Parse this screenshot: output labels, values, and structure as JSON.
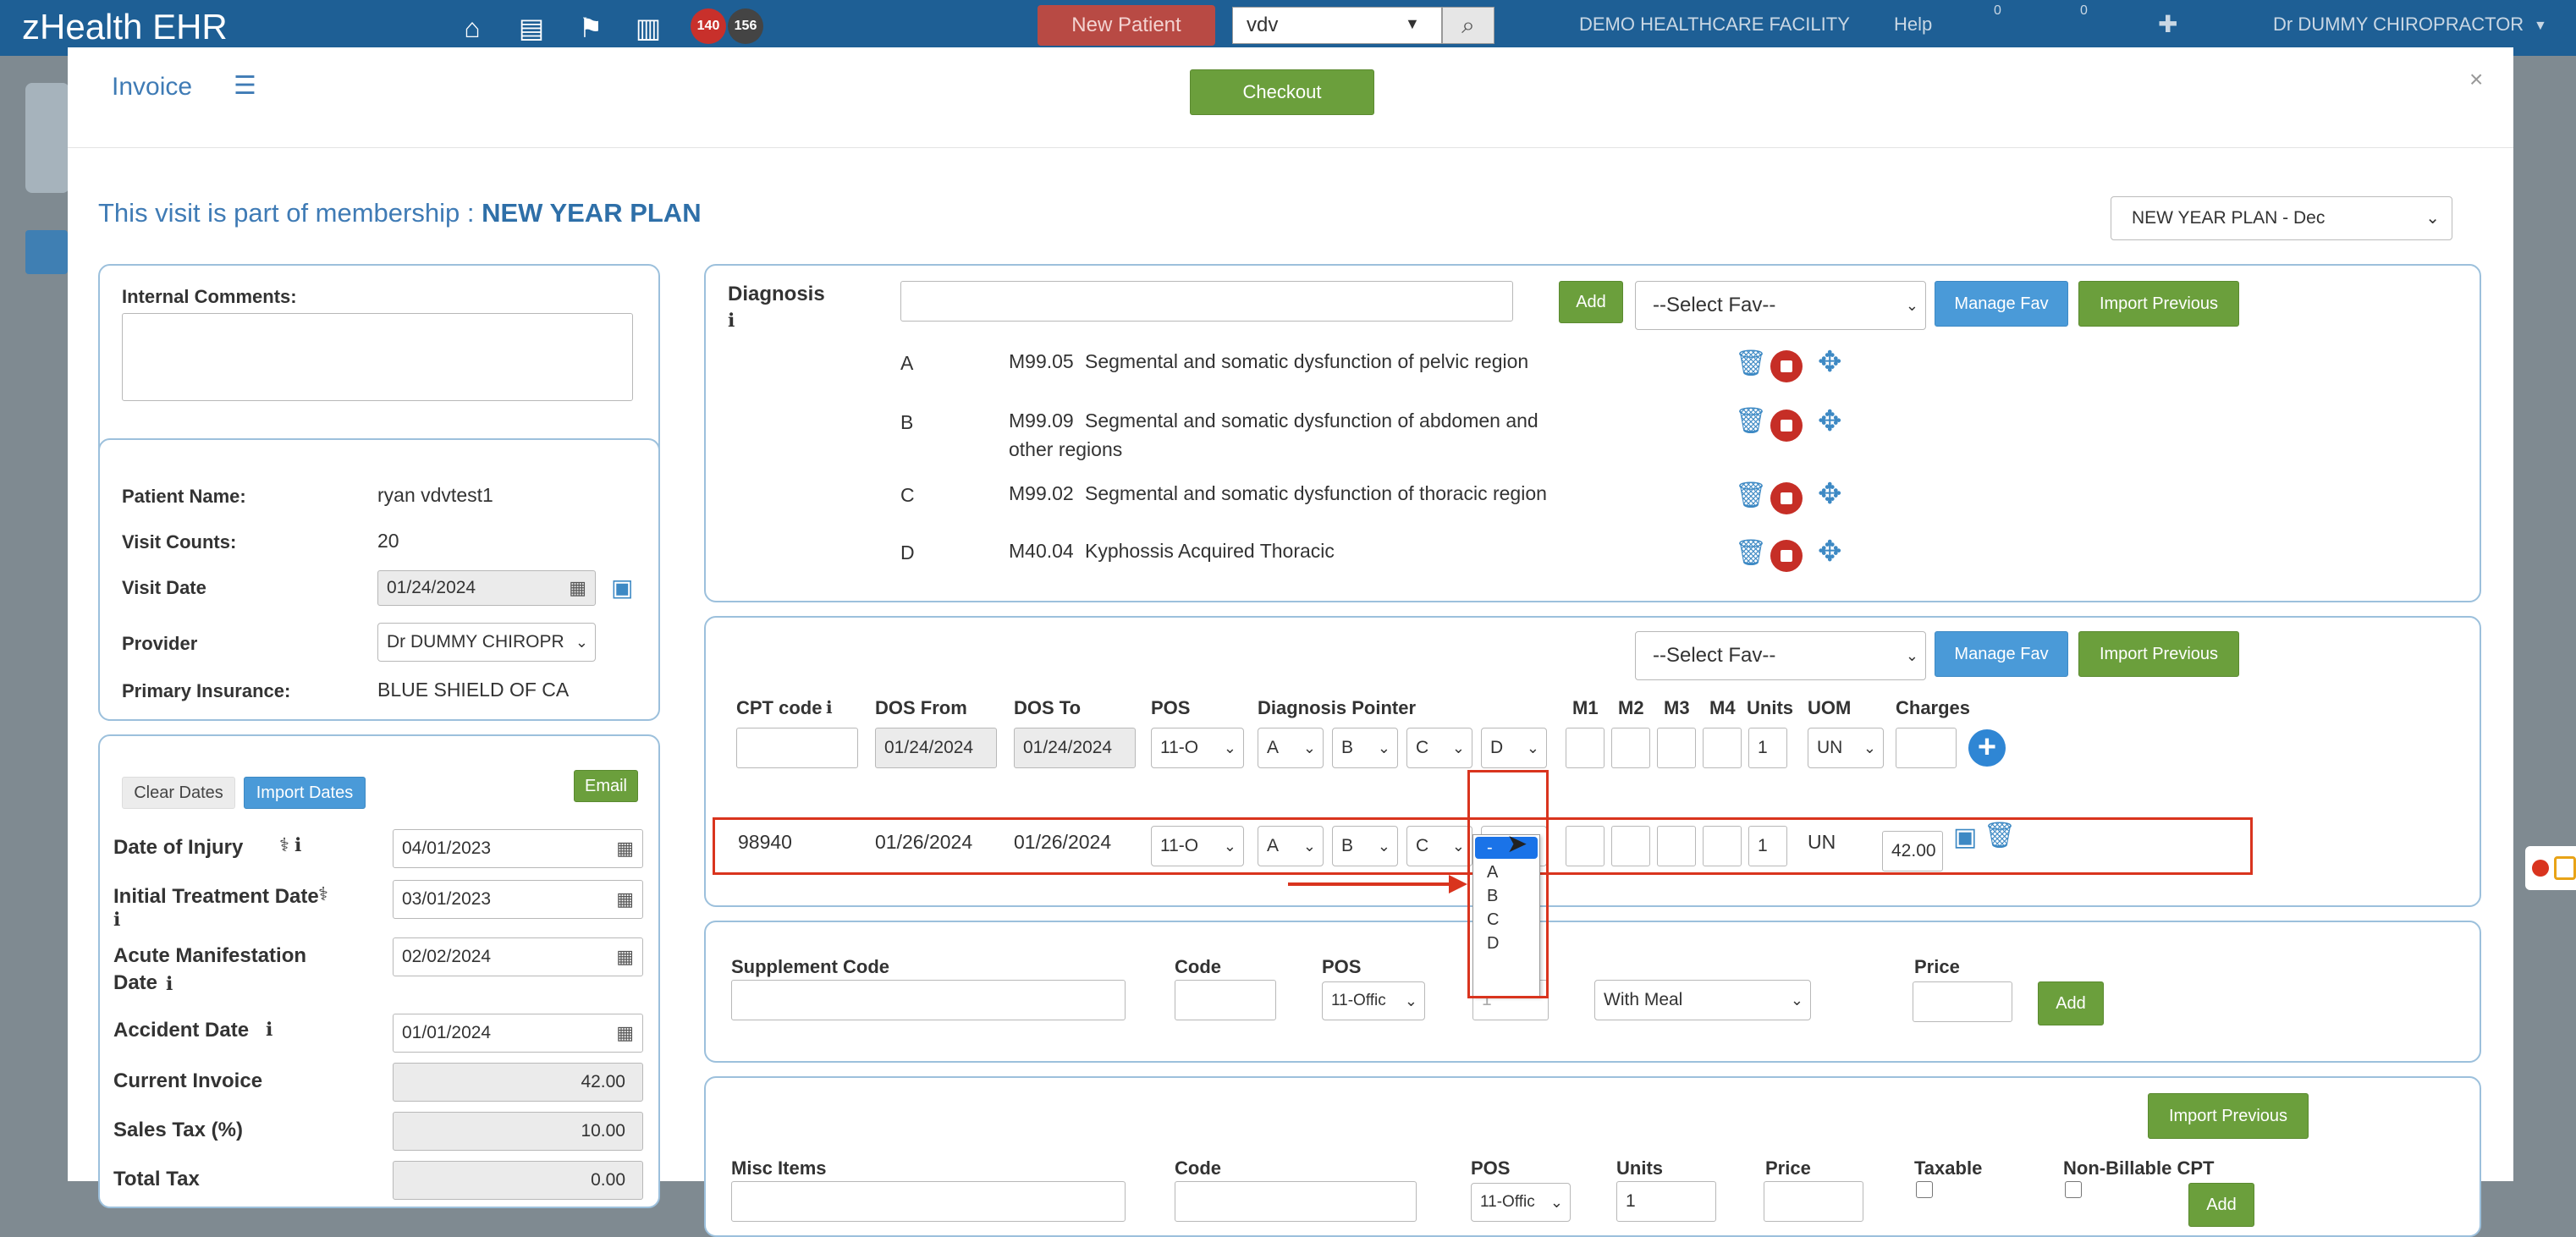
{
  "topbar": {
    "brand": "zHealth EHR",
    "badges": [
      "140",
      "156"
    ],
    "new_patient": "New Patient",
    "search_value": "vdv",
    "facility": "DEMO HEALTHCARE FACILITY",
    "help": "Help",
    "msg_count_1": "0",
    "msg_count_2": "0",
    "user": "Dr DUMMY CHIROPRACTOR"
  },
  "modal": {
    "title": "Invoice",
    "checkout": "Checkout",
    "close": "×",
    "membership_prefix": "This visit is part of membership : ",
    "membership_name": "NEW YEAR PLAN",
    "plan_select": "NEW YEAR PLAN - Dec"
  },
  "left": {
    "internal_comments_label": "Internal Comments:",
    "internal_comments_value": "",
    "patient_name_label": "Patient Name:",
    "patient_name": "ryan vdvtest1",
    "visit_counts_label": "Visit Counts:",
    "visit_counts": "20",
    "visit_date_label": "Visit Date",
    "visit_date": "01/24/2024",
    "provider_label": "Provider",
    "provider": "Dr DUMMY CHIROPR",
    "insurance_label": "Primary Insurance:",
    "insurance": "BLUE SHIELD OF CA",
    "clear_dates": "Clear Dates",
    "import_dates": "Import Dates",
    "email": "Email",
    "date_of_injury_label": "Date of Injury",
    "date_of_injury": "04/01/2023",
    "initial_treatment_label": "Initial Treatment Date",
    "initial_treatment": "03/01/2023",
    "acute_label_1": "Acute Manifestation",
    "acute_label_2": "Date",
    "acute": "02/02/2024",
    "accident_label": "Accident Date",
    "accident": "01/01/2024",
    "current_invoice_label": "Current Invoice",
    "current_invoice": "42.00",
    "sales_tax_label": "Sales Tax (%)",
    "sales_tax": "10.00",
    "total_tax_label": "Total Tax",
    "total_tax": "0.00"
  },
  "diagnosis": {
    "label": "Diagnosis",
    "search_value": "",
    "add": "Add",
    "select_fav": "--Select Fav--",
    "manage_fav": "Manage Fav",
    "import_previous": "Import Previous",
    "rows": [
      {
        "letter": "A",
        "code": "M99.05",
        "desc": "Segmental and somatic dysfunction of pelvic region",
        "desc2": ""
      },
      {
        "letter": "B",
        "code": "M99.09",
        "desc": "Segmental and somatic dysfunction of abdomen and",
        "desc2": "other regions"
      },
      {
        "letter": "C",
        "code": "M99.02",
        "desc": "Segmental and somatic dysfunction of thoracic region",
        "desc2": ""
      },
      {
        "letter": "D",
        "code": "M40.04",
        "desc": "Kyphossis Acquired Thoracic",
        "desc2": ""
      }
    ]
  },
  "cpt": {
    "select_fav": "--Select Fav--",
    "manage_fav": "Manage Fav",
    "import_previous": "Import Previous",
    "headers": {
      "cpt_code": "CPT code",
      "dos_from": "DOS From",
      "dos_to": "DOS To",
      "pos": "POS",
      "pointer": "Diagnosis Pointer",
      "m1": "M1",
      "m2": "M2",
      "m3": "M3",
      "m4": "M4",
      "units": "Units",
      "uom": "UOM",
      "charges": "Charges"
    },
    "new_row": {
      "cpt": "",
      "dos_from": "01/24/2024",
      "dos_to": "01/24/2024",
      "pos": "11-O",
      "p1": "A",
      "p2": "B",
      "p3": "C",
      "p4": "D",
      "units": "1",
      "uom": "UN",
      "charges": ""
    },
    "row": {
      "cpt": "98940",
      "dos_from": "01/26/2024",
      "dos_to": "01/26/2024",
      "pos": "11-O",
      "p1": "A",
      "p2": "B",
      "p3": "C",
      "p4": "D",
      "units": "1",
      "uom": "UN",
      "charges": "42.00"
    },
    "dropdown_options": [
      "-",
      "A",
      "B",
      "C",
      "D"
    ]
  },
  "supplement": {
    "label": "Supplement Code",
    "code_label": "Code",
    "pos_label": "POS",
    "pos": "11-Offic",
    "meal": "With Meal",
    "price_label": "Price",
    "add": "Add",
    "hidden_digit": "1"
  },
  "misc": {
    "import_previous": "Import Previous",
    "label": "Misc Items",
    "code_label": "Code",
    "pos_label": "POS",
    "pos": "11-Offic",
    "units_label": "Units",
    "units": "1",
    "price_label": "Price",
    "taxable_label": "Taxable",
    "nonbillable_label": "Non-Billable CPT",
    "add": "Add"
  },
  "colors": {
    "accent": "#3f7bb5",
    "green": "#6b9f3c",
    "blue": "#4a9ad8",
    "red": "#d9341e"
  }
}
